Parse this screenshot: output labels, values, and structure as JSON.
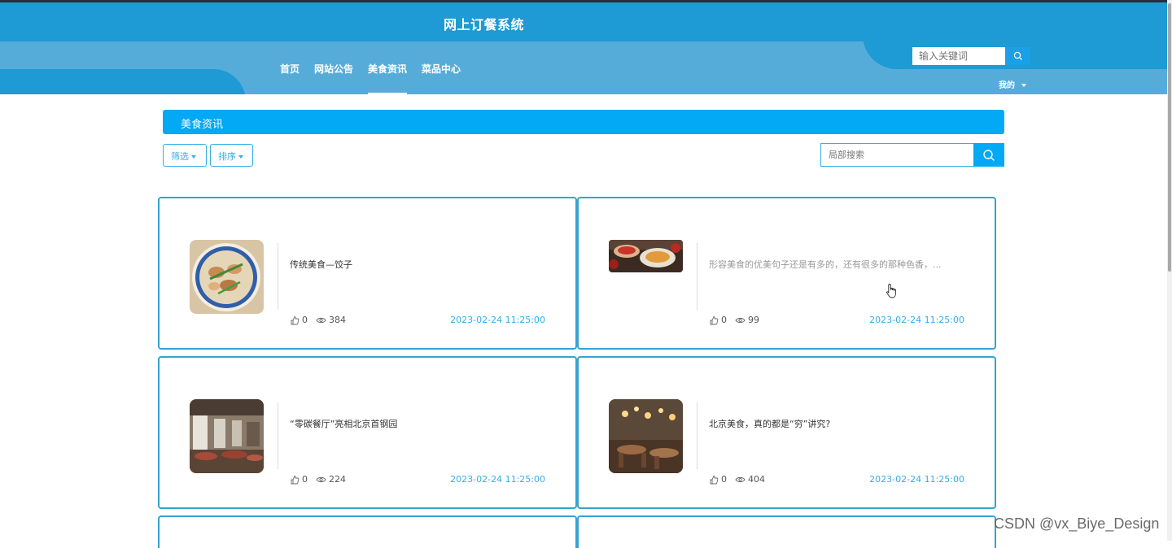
{
  "header": {
    "site_title": "网上订餐系统",
    "nav": [
      {
        "label": "首页"
      },
      {
        "label": "网站公告"
      },
      {
        "label": "美食资讯",
        "active": true
      },
      {
        "label": "菜品中心"
      }
    ],
    "search_placeholder": "输入关键词",
    "user_menu": "我的"
  },
  "page": {
    "section_title": "美食资讯",
    "filter_label": "筛选",
    "sort_label": "排序",
    "local_search_placeholder": "局部搜索"
  },
  "cards": [
    {
      "title": "传统美食—饺子",
      "likes": "0",
      "views": "384",
      "date": "2023-02-24 11:25:00",
      "image": "dumplings-photo"
    },
    {
      "title": "形容美食的优美句子还是有多的，还有很多的那种色香，...",
      "likes": "0",
      "views": "99",
      "date": "2023-02-24 11:25:00",
      "image": "food-banner-photo"
    },
    {
      "title": "“零碳餐厅”亮相北京首钢园",
      "likes": "0",
      "views": "224",
      "date": "2023-02-24 11:25:00",
      "image": "restaurant-interior-photo"
    },
    {
      "title": "北京美食，真的都是“穷”讲究?",
      "likes": "0",
      "views": "404",
      "date": "2023-02-24 11:25:00",
      "image": "dining-room-photo"
    }
  ],
  "watermark": "CSDN @vx_Biye_Design",
  "colors": {
    "header": "#1e9ad4",
    "band": "#55acd9",
    "accent": "#03a9f4",
    "card_border": "#35a3d1"
  }
}
